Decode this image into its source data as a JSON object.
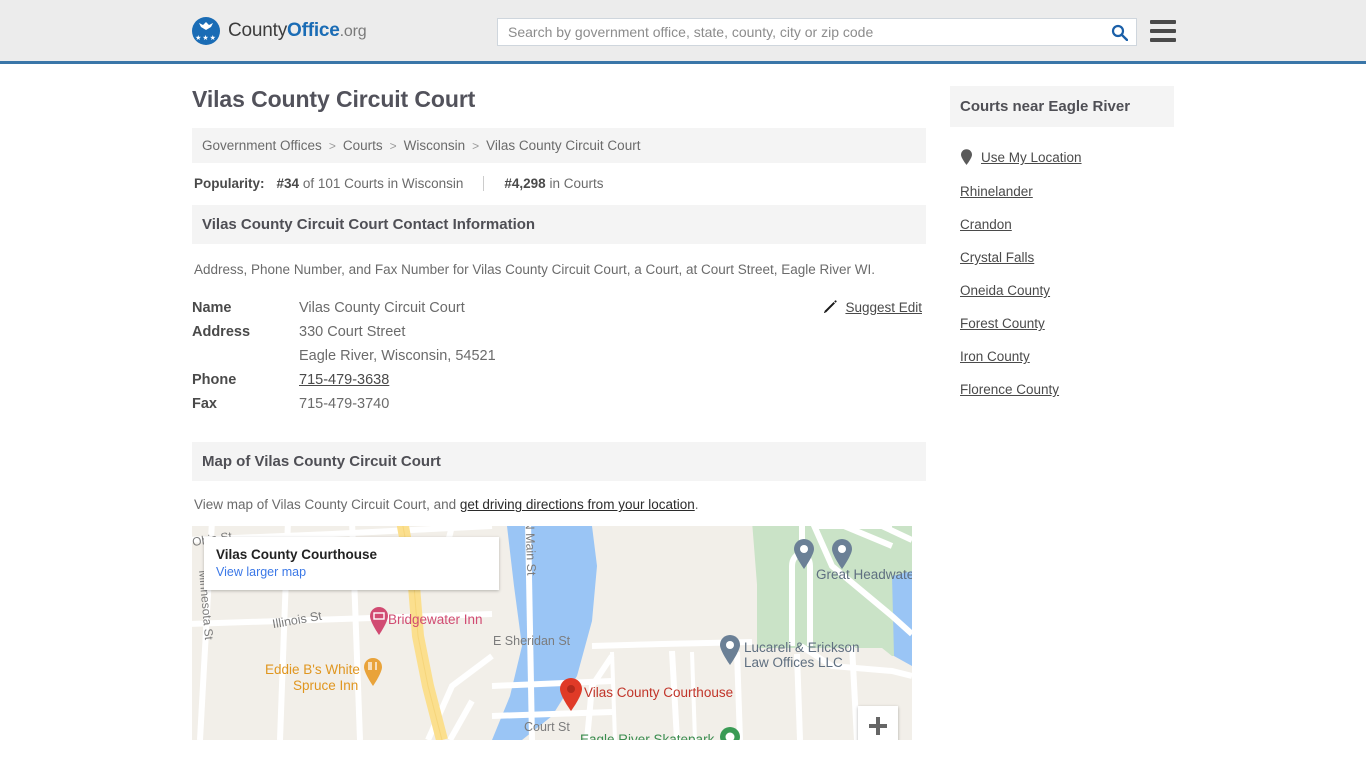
{
  "header": {
    "logo": {
      "part1": "County",
      "part2": "Office",
      "part3": ".org",
      "icon": "eagle-seal-icon"
    },
    "search": {
      "placeholder": "Search by government office, state, county, city or zip code",
      "value": "",
      "button_icon": "search-icon"
    },
    "menu_icon": "hamburger-menu-icon",
    "accent_color": "#3a76a8"
  },
  "page": {
    "title": "Vilas County Circuit Court"
  },
  "breadcrumb": {
    "items": [
      "Government Offices",
      "Courts",
      "Wisconsin",
      "Vilas County Circuit Court"
    ],
    "separator": ">"
  },
  "popularity": {
    "label": "Popularity:",
    "rank_state": "#34",
    "rank_state_suffix": "of 101 Courts in Wisconsin",
    "rank_overall": "#4,298",
    "rank_overall_suffix": "in Courts"
  },
  "contact": {
    "heading": "Vilas County Circuit Court Contact Information",
    "description": "Address, Phone Number, and Fax Number for Vilas County Circuit Court, a Court, at Court Street, Eagle River WI.",
    "suggest_edit": {
      "label": "Suggest Edit",
      "icon": "edit-pencil-icon"
    },
    "rows": [
      {
        "key": "Name",
        "value": "Vilas County Circuit Court",
        "link": false
      },
      {
        "key": "Address",
        "value": "330 Court Street",
        "link": false
      },
      {
        "key": "",
        "value": "Eagle River, Wisconsin, 54521",
        "link": false
      },
      {
        "key": "Phone",
        "value": "715-479-3638",
        "link": true
      },
      {
        "key": "Fax",
        "value": "715-479-3740",
        "link": false
      }
    ]
  },
  "map_section": {
    "heading": "Map of Vilas County Circuit Court",
    "description_prefix": "View map of Vilas County Circuit Court, and ",
    "description_link": "get driving directions from your location",
    "description_suffix": ".",
    "card": {
      "title": "Vilas County Courthouse",
      "link": "View larger map"
    },
    "zoom_in_icon": "plus-icon",
    "labels": [
      "Ohio St",
      "Minnesota St",
      "Illinois St",
      "N Main St",
      "E Sheridan St",
      "Court St",
      "Bridgewater Inn",
      "Eddie B's White",
      "Spruce Inn",
      "Vilas County Courthouse",
      "Lucareli & Erickson",
      "Law Offices LLC",
      "Great Headwater",
      "Eagle River Skatepark"
    ],
    "colors": {
      "water": "#9ac5f5",
      "park": "#cae3c7",
      "road": "#ffffff",
      "highway": "#fbdf8e",
      "marker_red": "#e03a27"
    }
  },
  "sidebar": {
    "heading": "Courts near Eagle River",
    "items": [
      {
        "label": "Use My Location",
        "icon": "map-pin-icon"
      },
      {
        "label": "Rhinelander",
        "icon": ""
      },
      {
        "label": "Crandon",
        "icon": ""
      },
      {
        "label": "Crystal Falls",
        "icon": ""
      },
      {
        "label": "Oneida County",
        "icon": ""
      },
      {
        "label": "Forest County",
        "icon": ""
      },
      {
        "label": "Iron County",
        "icon": ""
      },
      {
        "label": "Florence County",
        "icon": ""
      }
    ]
  }
}
